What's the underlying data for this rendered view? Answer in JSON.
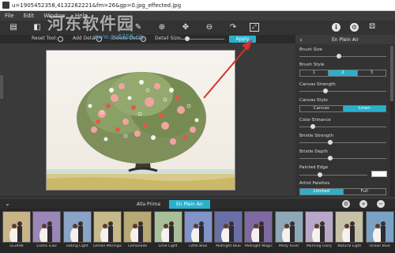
{
  "window": {
    "title": "u=1905452358,4132262221&fm=26&gp=0.jpg_effected.jpg"
  },
  "menu": [
    "File",
    "Edit",
    "Window",
    "Help"
  ],
  "options": {
    "reset_tool": "Reset Tool:",
    "add_detail": "Add Detail:",
    "delete_detail": "Delete Detail:",
    "detail_size": "Detail Size:",
    "apply": "Apply",
    "detail_size_value": 0.25
  },
  "side_panel": {
    "title": "En Plein Air",
    "brush_size": {
      "label": "Brush Size",
      "value": 0.45
    },
    "brush_style": {
      "label": "Brush Style",
      "options": [
        "1",
        "2",
        "3"
      ],
      "selected": "2"
    },
    "canvas_strength": {
      "label": "Canvas Strength",
      "value": 0.3
    },
    "canvas_style": {
      "label": "Canvas Style",
      "options": [
        "Canvas",
        "Linen"
      ],
      "selected": "Linen"
    },
    "color_enhance": {
      "label": "Color Enhance",
      "value": 0.15
    },
    "bristle_strength": {
      "label": "Bristle Strength",
      "value": 0.35
    },
    "bristle_depth": {
      "label": "Bristle Depth",
      "value": 0.35
    },
    "painted_edge": {
      "label": "Painted Edge",
      "value": 0.3,
      "swatch": "#ffffff"
    },
    "artist_palettes": {
      "label": "Artist Palettes",
      "options": [
        "Limited",
        "Full"
      ],
      "selected": "Limited"
    }
  },
  "tabs": {
    "items": [
      "Alla Prima",
      "En Plein Air"
    ],
    "active": "En Plein Air"
  },
  "presets": [
    "LE3498",
    "Exotic Lilac",
    "Fading Light",
    "Lemon Meringue",
    "Lemonade",
    "Lime Light",
    "Little Blue",
    "Midnight Blue",
    "Midnight Magic",
    "Misty River",
    "Morning Glory",
    "Natural Light",
    "Ocean Blue"
  ],
  "watermark": {
    "main": "河东软件园",
    "sub": "www.pc0359.cn"
  },
  "colors": {
    "accent": "#2ab0cc",
    "bg": "#2f2f2f"
  }
}
